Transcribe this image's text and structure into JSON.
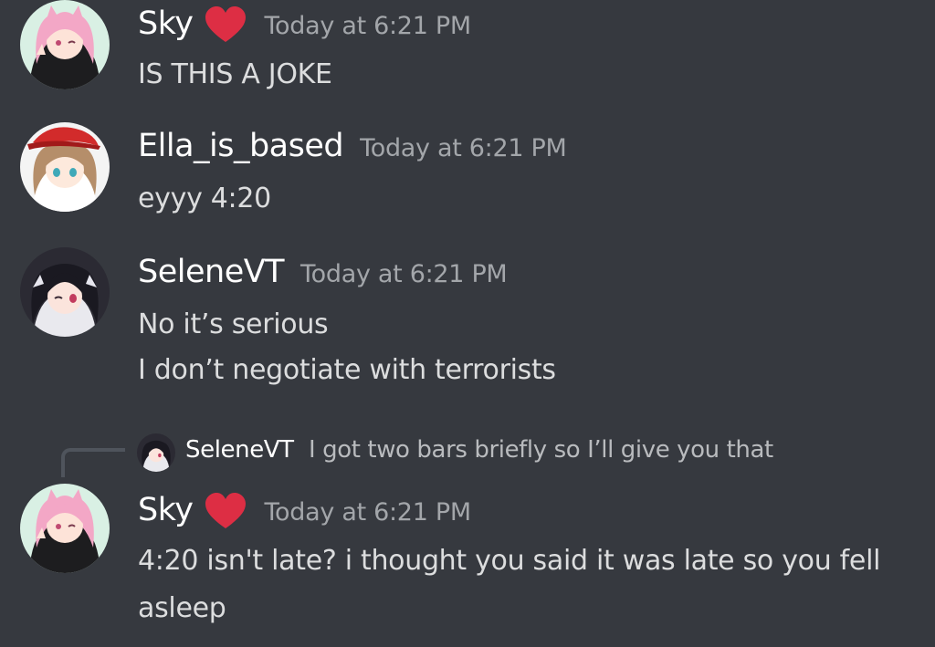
{
  "colors": {
    "background": "#36393f",
    "username": "#ffffff",
    "timestamp": "#a3a6aa",
    "text": "#dcddde",
    "reply_text": "#b9bbbe",
    "reply_line": "#4f545c",
    "heart": "#dd2e44"
  },
  "messages": [
    {
      "author": "Sky",
      "badge": "heart-emoji",
      "timestamp": "Today at 6:21 PM",
      "lines": [
        "IS THIS A JOKE"
      ]
    },
    {
      "author": "Ella_is_based",
      "timestamp": "Today at 6:21 PM",
      "lines": [
        "eyyy 4:20"
      ]
    },
    {
      "author": "SeleneVT",
      "timestamp": "Today at 6:21 PM",
      "lines": [
        "No it’s serious",
        "I don’t negotiate with terrorists"
      ]
    },
    {
      "reply": {
        "author": "SeleneVT",
        "text": "I got two bars briefly so I’ll give you that"
      },
      "author": "Sky",
      "badge": "heart-emoji",
      "timestamp": "Today at 6:21 PM",
      "lines": [
        "4:20 isn't late? i thought you said it was late so you fell",
        "asleep"
      ]
    }
  ]
}
